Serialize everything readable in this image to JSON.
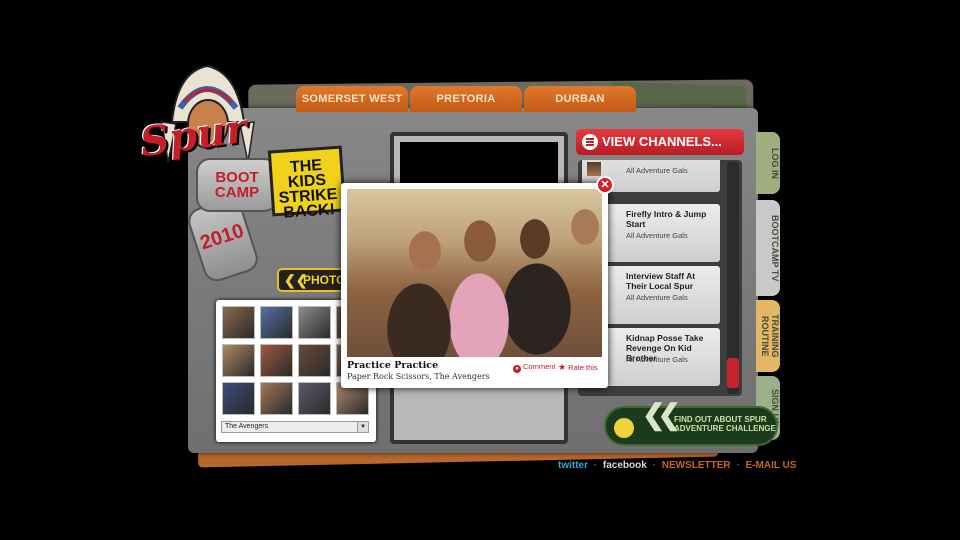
{
  "city_tabs": [
    {
      "label": "SOMERSET WEST"
    },
    {
      "label": "PRETORIA"
    },
    {
      "label": "DURBAN"
    }
  ],
  "logo": {
    "brand": "Spur",
    "tag_main": "BOOT CAMP",
    "tag_year": "2010"
  },
  "kids_badge": "THE KIDS STRIKE BACK!",
  "photos_button": "PHOTOS",
  "channels": {
    "button_label": "VIEW CHANNELS...",
    "items": [
      {
        "title": "",
        "subtitle": "All Adventure Gals"
      },
      {
        "title": "Firefly Intro & Jump Start",
        "subtitle": "All Adventure Gals"
      },
      {
        "title": "Interview Staff At Their Local Spur",
        "subtitle": "All Adventure Gals"
      },
      {
        "title": "Kidnap Posse Take Revenge On Kid Brother",
        "subtitle": "All Adventure Gals"
      }
    ]
  },
  "side_tabs": [
    {
      "label": "LOG IN",
      "color": "#9fae7f"
    },
    {
      "label": "BOOTCAMP TV",
      "color": "#c9c9c9"
    },
    {
      "label": "TRAINING ROUTINE",
      "color": "#e3b865"
    },
    {
      "label": "SIGN UP",
      "color": "#9bb08a"
    }
  ],
  "adventure_button": "FIND OUT ABOUT SPUR ADVENTURE CHALLENGE",
  "footer": {
    "twitter": "twitter",
    "facebook": "facebook",
    "newsletter": "NEWSLETTER",
    "email": "E-MAIL US"
  },
  "gallery": {
    "thumb_colors": [
      "#8a6a4e",
      "#5470a6",
      "#8d8d8d",
      "#7a5d44",
      "#b08a62",
      "#9e5a3e",
      "#6a4b3a",
      "#8e6a52",
      "#3e4a78",
      "#a07858",
      "#5a5a6e",
      "#b08a70"
    ],
    "selected_option": "The Avengers"
  },
  "popup": {
    "title": "Practice Practice",
    "caption": "Paper Rock Scissors, The Avengers",
    "comment_label": "Comment",
    "rate_label": "Rate this"
  }
}
